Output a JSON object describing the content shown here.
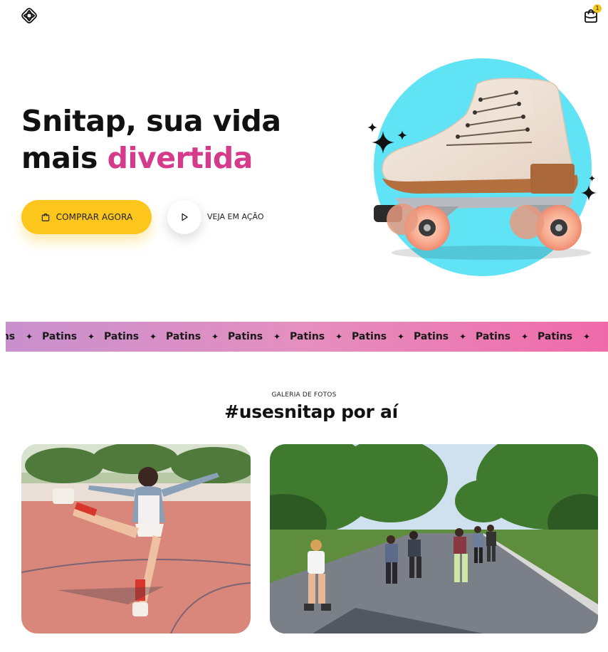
{
  "header": {
    "logo_icon": "snitap-logo-icon",
    "cart_icon": "shopping-bag-icon",
    "cart_count": "1"
  },
  "hero": {
    "title_line1": "Snitap, sua vida",
    "title_line2_plain": "mais ",
    "title_line2_accent": "divertida",
    "accent_color": "#d63a8b",
    "buy_button_label": "COMPRAR AGORA",
    "buy_button_icon": "shopping-bag-icon",
    "buy_button_color": "#fcc61c",
    "play_button_icon": "play-icon",
    "play_label": "VEJA EM AÇÃO",
    "circle_color": "#5fe3f5"
  },
  "marquee": {
    "word": "Patins",
    "separator_icon": "sparkle-icon",
    "items": [
      "Patins",
      "Patins",
      "Patins",
      "Patins",
      "Patins",
      "Patins",
      "Patins",
      "Patins",
      "Patins",
      "Patins"
    ]
  },
  "gallery": {
    "kicker": "GALERIA DE FOTOS",
    "title": "#usesnitap por aí",
    "photos": [
      {
        "subject": "woman-skating-on-court-photo"
      },
      {
        "subject": "group-skating-in-park-photo"
      }
    ]
  }
}
